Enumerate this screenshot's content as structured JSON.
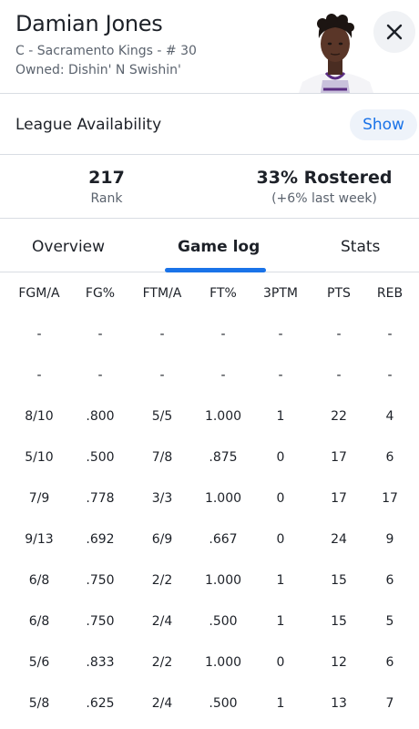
{
  "player": {
    "name": "Damian Jones",
    "position_team": "C - Sacramento Kings - # 30",
    "owner": "Owned: Dishin' N Swishin'"
  },
  "close_icon": "close-icon",
  "availability": {
    "label": "League Availability",
    "show_label": "Show"
  },
  "stats": {
    "rank_value": "217",
    "rank_label": "Rank",
    "rostered_value": "33% Rostered",
    "rostered_change": "(+6% last week)"
  },
  "tabs": [
    {
      "label": "Overview",
      "active": false
    },
    {
      "label": "Game log",
      "active": true
    },
    {
      "label": "Stats",
      "active": false
    }
  ],
  "colors": {
    "accent": "#1a73e8",
    "text": "#1d2128",
    "muted": "#5b636e"
  },
  "gamelog": {
    "columns": [
      "FGM/A",
      "FG%",
      "FTM/A",
      "FT%",
      "3PTM",
      "PTS",
      "REB"
    ],
    "rows": [
      [
        "-",
        "-",
        "-",
        "-",
        "-",
        "-",
        "-"
      ],
      [
        "-",
        "-",
        "-",
        "-",
        "-",
        "-",
        "-"
      ],
      [
        "8/10",
        ".800",
        "5/5",
        "1.000",
        "1",
        "22",
        "4"
      ],
      [
        "5/10",
        ".500",
        "7/8",
        ".875",
        "0",
        "17",
        "6"
      ],
      [
        "7/9",
        ".778",
        "3/3",
        "1.000",
        "0",
        "17",
        "17"
      ],
      [
        "9/13",
        ".692",
        "6/9",
        ".667",
        "0",
        "24",
        "9"
      ],
      [
        "6/8",
        ".750",
        "2/2",
        "1.000",
        "1",
        "15",
        "6"
      ],
      [
        "6/8",
        ".750",
        "2/4",
        ".500",
        "1",
        "15",
        "5"
      ],
      [
        "5/6",
        ".833",
        "2/2",
        "1.000",
        "0",
        "12",
        "6"
      ],
      [
        "5/8",
        ".625",
        "2/4",
        ".500",
        "1",
        "13",
        "7"
      ]
    ]
  }
}
